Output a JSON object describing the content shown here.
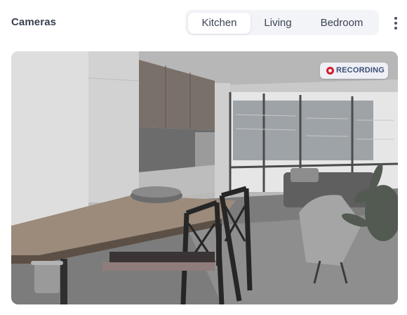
{
  "header": {
    "title": "Cameras"
  },
  "tabs": [
    {
      "label": "Kitchen",
      "active": true
    },
    {
      "label": "Living",
      "active": false
    },
    {
      "label": "Bedroom",
      "active": false
    }
  ],
  "more_menu": {
    "icon": "vertical-ellipsis-icon"
  },
  "camera": {
    "status_label": "RECORDING",
    "status_icon": "record-dot-icon",
    "status_color": "#d61b2a"
  },
  "colors": {
    "title_text": "#38404f",
    "tab_background": "#f3f4f8",
    "badge_text": "#3d4d76"
  }
}
